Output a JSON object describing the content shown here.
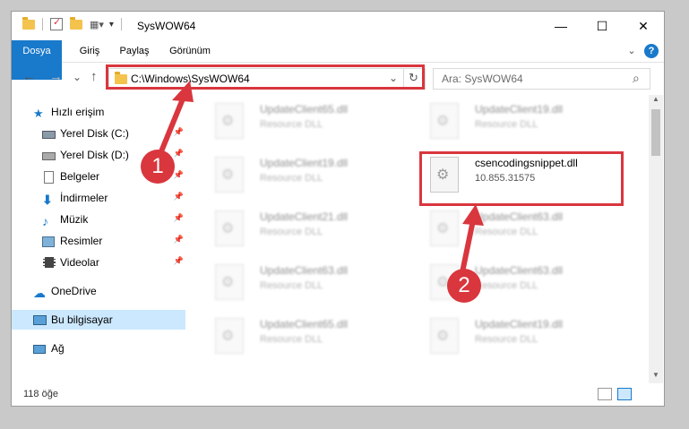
{
  "window": {
    "title": "SysWOW64",
    "minimize": "—",
    "maximize": "☐",
    "close": "✕"
  },
  "ribbon": {
    "tabs": [
      "Dosya",
      "Giriş",
      "Paylaş",
      "Görünüm"
    ],
    "expand": "⌄",
    "help": "?"
  },
  "nav": {
    "back": "←",
    "forward": "→",
    "recent": "⌄",
    "up": "↑"
  },
  "address": {
    "path": "C:\\Windows\\SysWOW64",
    "dropdown": "⌄",
    "refresh": "↻"
  },
  "search": {
    "placeholder": "Ara: SysWOW64",
    "icon": "⌕"
  },
  "sidebar": {
    "quick_access": "Hızlı erişim",
    "items": [
      {
        "label": "Yerel Disk (C:)",
        "pinned": true
      },
      {
        "label": "Yerel Disk (D:)",
        "pinned": true
      },
      {
        "label": "Belgeler",
        "pinned": true
      },
      {
        "label": "İndirmeler",
        "pinned": true
      },
      {
        "label": "Müzik",
        "pinned": true
      },
      {
        "label": "Resimler",
        "pinned": true
      },
      {
        "label": "Videolar",
        "pinned": true
      }
    ],
    "onedrive": "OneDrive",
    "this_pc": "Bu bilgisayar",
    "network": "Ağ"
  },
  "files": {
    "highlighted": {
      "name": "csencodingsnippet.dll",
      "version": "10.855.31575"
    },
    "left_column": [
      {
        "name": "UpdateClient65.dll",
        "type": "Resource DLL"
      },
      {
        "name": "UpdateClient19.dll",
        "type": "Resource DLL"
      },
      {
        "name": "UpdateClient21.dll",
        "type": "Resource DLL"
      },
      {
        "name": "UpdateClient63.dll",
        "type": "Resource DLL"
      },
      {
        "name": "UpdateClient65.dll",
        "type": "Resource DLL"
      }
    ],
    "right_column": [
      {
        "name": "UpdateClient19.dll",
        "type": "Resource DLL"
      },
      {
        "name": "UpdateClient63.dll",
        "type": "Resource DLL"
      },
      {
        "name": "UpdateClient63.dll",
        "type": "Resource DLL"
      },
      {
        "name": "UpdateClient19.dll",
        "type": "Resource DLL"
      }
    ]
  },
  "status": {
    "count": "118 öğe"
  },
  "callouts": [
    "1",
    "2"
  ],
  "colors": {
    "accent": "#1979ca",
    "highlight": "#d9363e",
    "selection": "#cce8ff"
  }
}
